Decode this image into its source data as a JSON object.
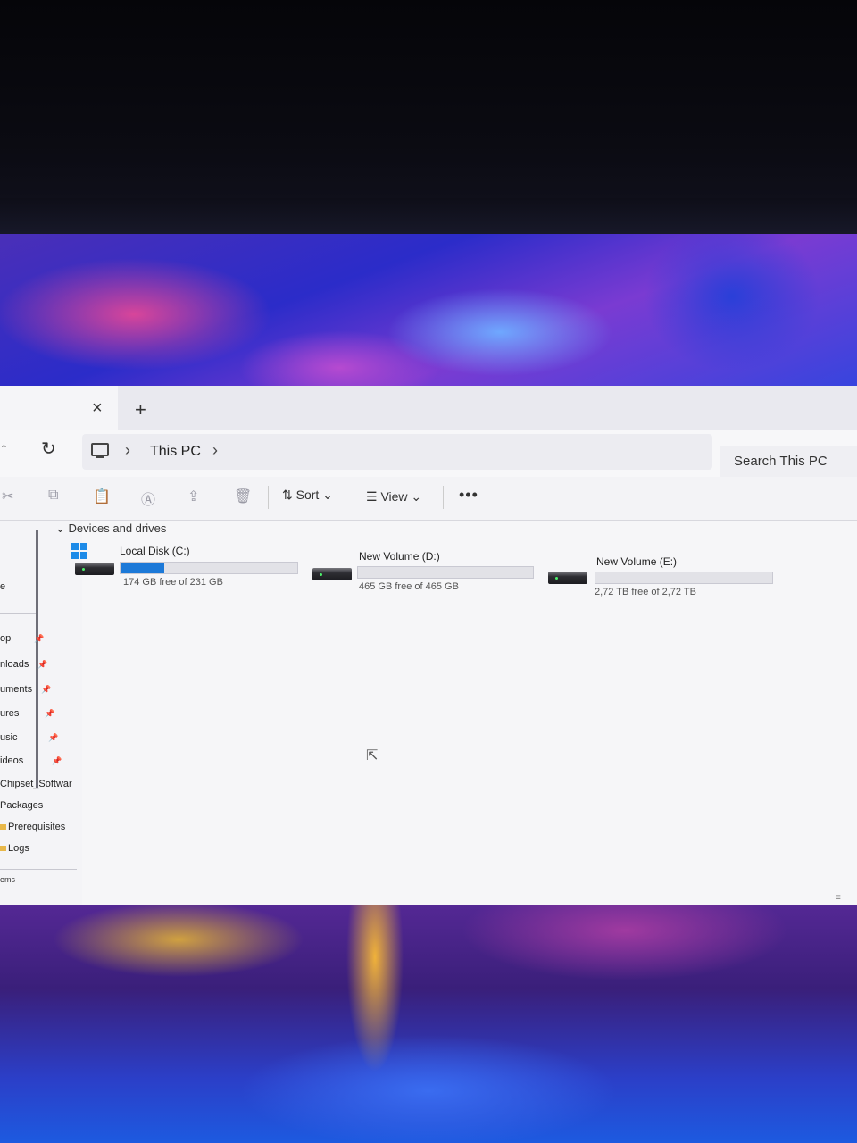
{
  "tab": {
    "close_icon": "×",
    "new_tab_icon": "+"
  },
  "nav": {
    "up_icon": "↑",
    "refresh_icon": "↻"
  },
  "breadcrumb": {
    "separator": "›",
    "location": "This PC",
    "trailing_separator": "›"
  },
  "search": {
    "placeholder": "Search This PC"
  },
  "commands": {
    "icons": [
      "cut-icon",
      "copy-icon",
      "paste-icon",
      "rename-icon",
      "share-icon",
      "delete-icon"
    ],
    "cut": "✂",
    "copy": "⧉",
    "paste": "📋",
    "rename": "Ⓐ",
    "share": "⇪",
    "delete": "🗑",
    "sort_label": "⇅  Sort  ⌄",
    "view_label": "☰  View  ⌄",
    "more_label": "•••"
  },
  "sidebar": {
    "items": [
      {
        "label": "e"
      },
      {
        "label": "op",
        "pinned": true
      },
      {
        "label": "nloads",
        "pinned": true
      },
      {
        "label": "uments",
        "pinned": true
      },
      {
        "label": "ures",
        "pinned": true
      },
      {
        "label": "usic",
        "pinned": true
      },
      {
        "label": "ideos",
        "pinned": true
      },
      {
        "label": "Chipset_Softwar"
      },
      {
        "label": "Packages"
      },
      {
        "label": "Prerequisites"
      },
      {
        "label": "Logs"
      }
    ],
    "pin_icon": "📌"
  },
  "main": {
    "section_title": "⌄  Devices and drives",
    "drives": [
      {
        "name": "Local Disk (C:)",
        "free_text": "174 GB free of 231 GB",
        "used_fraction": 0.247,
        "system": true
      },
      {
        "name": "New Volume (D:)",
        "free_text": "465 GB free of 465 GB",
        "used_fraction": 0.0
      },
      {
        "name": "New Volume (E:)",
        "free_text": "2,72 TB free of 2,72 TB",
        "used_fraction": 0.0
      }
    ]
  },
  "status": {
    "text": "ems",
    "grip_icon": "≡"
  },
  "colors": {
    "accent": "#1c79d8",
    "window_bg": "#f6f6f8"
  }
}
